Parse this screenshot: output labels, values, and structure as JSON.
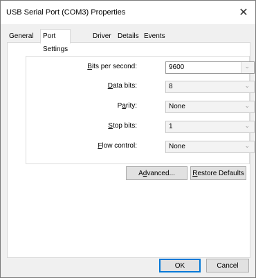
{
  "window": {
    "title": "USB Serial Port (COM3) Properties",
    "close_glyph": "✕"
  },
  "tabs": [
    {
      "label": "General"
    },
    {
      "label": "Port Settings"
    },
    {
      "label": "Driver"
    },
    {
      "label": "Details"
    },
    {
      "label": "Events"
    }
  ],
  "active_tab": "Port Settings",
  "settings": {
    "bits_per_second": {
      "label_mnemonic": "B",
      "label_rest": "its per second:",
      "value": "9600"
    },
    "data_bits": {
      "label_mnemonic": "D",
      "label_rest": "ata bits:",
      "value": "8"
    },
    "parity": {
      "label_pre": "P",
      "label_mnemonic": "a",
      "label_rest": "rity:",
      "value": "None"
    },
    "stop_bits": {
      "label_mnemonic": "S",
      "label_rest": "top bits:",
      "value": "1"
    },
    "flow_control": {
      "label_mnemonic": "F",
      "label_rest": "low control:",
      "value": "None"
    }
  },
  "buttons": {
    "advanced": {
      "pre": "A",
      "mnemonic": "d",
      "rest": "vanced..."
    },
    "restore": {
      "mnemonic": "R",
      "rest": "estore Defaults"
    },
    "ok": "OK",
    "cancel": "Cancel"
  },
  "icons": {
    "dropdown": "chevron-down-icon",
    "close": "close-icon"
  }
}
